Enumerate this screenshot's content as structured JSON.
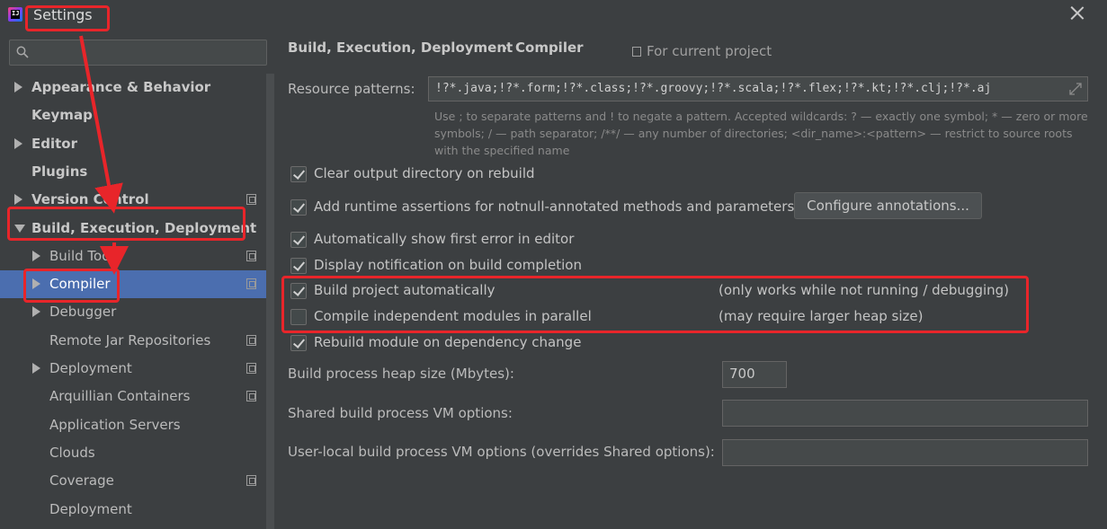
{
  "window": {
    "title": "Settings",
    "app_icon_text": "IJ"
  },
  "search": {
    "placeholder": "",
    "value": ""
  },
  "sidebar": {
    "items": [
      {
        "label": "Appearance & Behavior",
        "arrow": "right",
        "bold": true
      },
      {
        "label": "Keymap",
        "arrow": "",
        "bold": true
      },
      {
        "label": "Editor",
        "arrow": "right",
        "bold": true
      },
      {
        "label": "Plugins",
        "arrow": "",
        "bold": true
      },
      {
        "label": "Version Control",
        "arrow": "right",
        "bold": true,
        "project_icon": true
      },
      {
        "label": "Build, Execution, Deployment",
        "arrow": "down",
        "bold": true
      },
      {
        "label": "Build Tools",
        "arrow": "right",
        "bold": false,
        "project_icon": true
      },
      {
        "label": "Compiler",
        "arrow": "right",
        "bold": false,
        "project_icon": true,
        "selected": true
      },
      {
        "label": "Debugger",
        "arrow": "right",
        "bold": false
      },
      {
        "label": "Remote Jar Repositories",
        "arrow": "",
        "bold": false,
        "project_icon": true
      },
      {
        "label": "Deployment",
        "arrow": "right",
        "bold": false,
        "project_icon": true
      },
      {
        "label": "Arquillian Containers",
        "arrow": "",
        "bold": false,
        "project_icon": true
      },
      {
        "label": "Application Servers",
        "arrow": "",
        "bold": false
      },
      {
        "label": "Clouds",
        "arrow": "",
        "bold": false
      },
      {
        "label": "Coverage",
        "arrow": "",
        "bold": false,
        "project_icon": true
      },
      {
        "label": "Deployment",
        "arrow": "",
        "bold": false
      }
    ]
  },
  "breadcrumb": {
    "parent": "Build, Execution, Deployment",
    "separator": "›",
    "current": "Compiler",
    "scope": "For current project"
  },
  "resource_patterns": {
    "label": "Resource patterns:",
    "value": "!?*.java;!?*.form;!?*.class;!?*.groovy;!?*.scala;!?*.flex;!?*.kt;!?*.clj;!?*.aj",
    "hint_line1": "Use ; to separate patterns and ! to negate a pattern. Accepted wildcards: ? — exactly one symbol; * — zero or more",
    "hint_line2": "symbols; / — path separator; /**/ — any number of directories; <dir_name>:<pattern> — restrict to source roots",
    "hint_line3": "with the specified name"
  },
  "options": [
    {
      "label": "Clear output directory on rebuild",
      "checked": true,
      "note": ""
    },
    {
      "label": "Add runtime assertions for notnull-annotated methods and parameters",
      "checked": true,
      "note": ""
    },
    {
      "label": "Automatically show first error in editor",
      "checked": true,
      "note": ""
    },
    {
      "label": "Display notification on build completion",
      "checked": true,
      "note": ""
    },
    {
      "label": "Build project automatically",
      "checked": true,
      "note": "(only works while not running / debugging)"
    },
    {
      "label": "Compile independent modules in parallel",
      "checked": false,
      "note": "(may require larger heap size)"
    },
    {
      "label": "Rebuild module on dependency change",
      "checked": true,
      "note": ""
    }
  ],
  "configure_button": "Configure annotations...",
  "heap": {
    "label": "Build process heap size (Mbytes):",
    "value": "700"
  },
  "shared_vm": {
    "label": "Shared build process VM options:",
    "value": ""
  },
  "user_vm": {
    "label": "User-local build process VM options (overrides Shared options):",
    "value": ""
  },
  "colors": {
    "selection": "#4b6eaf",
    "annotation": "#e8252a",
    "background": "#3c3f41"
  }
}
